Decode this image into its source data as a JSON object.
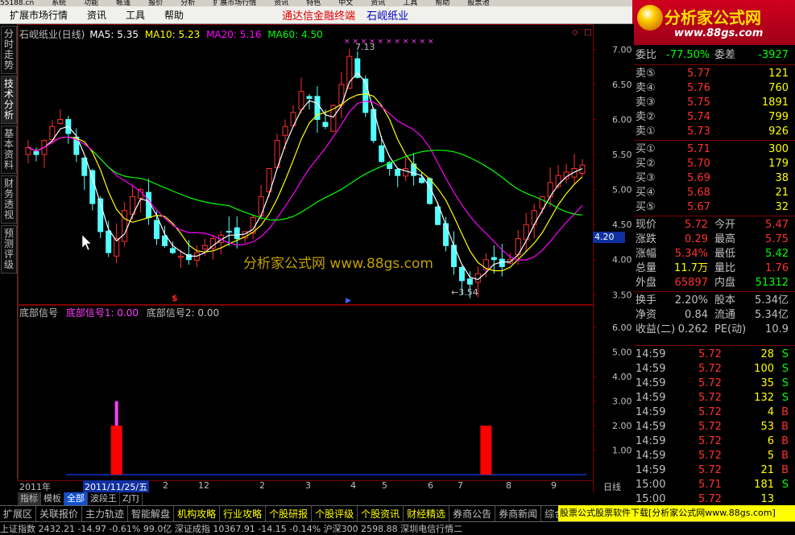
{
  "topstrip": [
    "55188.cn",
    "系统",
    "功能",
    "帐篷",
    "报价",
    "分析",
    "扩展市场行情",
    "资讯",
    "特色",
    "中文",
    "资讯",
    "工具",
    "帮助",
    "股票池"
  ],
  "menubar": {
    "items": [
      "扩展市场行情",
      "资讯",
      "工具",
      "帮助"
    ],
    "title": "通达信金融终端",
    "stock": "石岘纸业"
  },
  "logo": {
    "name": "分析家公式网",
    "url": "www.88gs.com"
  },
  "left_tabs": [
    "分时走势",
    "技术分析",
    "基本资料",
    "财务透视",
    "预测评级"
  ],
  "ma_header": {
    "stock": "石岘纸业(日线)",
    "ma5": "MA5: 5.35",
    "ma10": "MA10: 5.23",
    "ma20": "MA20: 5.16",
    "ma60": "MA60: 4.50"
  },
  "price_axis": [
    "7.00",
    "6.50",
    "6.00",
    "5.50",
    "5.00",
    "4.50",
    "4.00",
    "3.50"
  ],
  "current_price_tag": "4.20",
  "annotations": {
    "high": "7.13",
    "low": "3.54",
    "watermark": "分析家公式网 www.88gs.com"
  },
  "indicator_header": {
    "name": "底部信号",
    "s1": "底部信号1: 0.00",
    "s2": "底部信号2: 0.00"
  },
  "indicator_axis": [
    "6.00",
    "5.00",
    "4.00",
    "3.00",
    "2.00",
    "1.00"
  ],
  "time_axis": {
    "year": "2011年",
    "cursor": "2011/11/25/五",
    "ticks": [
      "2",
      "12",
      "2",
      "3",
      "4",
      "5",
      "6",
      "7",
      "8",
      "9"
    ],
    "period": "日线"
  },
  "chart_data": {
    "type": "candlestick",
    "title": "石岘纸业(日线)",
    "ylim": [
      3.4,
      7.2
    ],
    "highest": 7.13,
    "lowest": 3.54,
    "moving_averages": [
      {
        "name": "MA5",
        "value": 5.35,
        "color": "#ffffff"
      },
      {
        "name": "MA10",
        "value": 5.23,
        "color": "#ffff00"
      },
      {
        "name": "MA20",
        "value": 5.16,
        "color": "#ff00ff"
      },
      {
        "name": "MA60",
        "value": 4.5,
        "color": "#00ff00"
      }
    ],
    "closes": [
      5.6,
      5.5,
      5.7,
      5.9,
      6.0,
      5.8,
      5.5,
      5.2,
      4.8,
      4.4,
      4.1,
      4.3,
      4.7,
      4.9,
      5.0,
      4.6,
      4.3,
      4.2,
      4.1,
      4.05,
      4.0,
      4.1,
      4.2,
      4.3,
      4.35,
      4.4,
      4.3,
      4.4,
      4.6,
      4.9,
      5.3,
      5.7,
      5.9,
      6.1,
      6.4,
      6.3,
      6.0,
      5.9,
      6.2,
      6.5,
      6.9,
      6.6,
      6.1,
      5.7,
      5.4,
      5.3,
      5.2,
      5.3,
      5.2,
      5.1,
      4.8,
      4.5,
      4.2,
      3.9,
      3.7,
      3.65,
      3.8,
      4.0,
      4.0,
      3.9,
      4.0,
      4.3,
      4.5,
      4.7,
      4.9,
      5.1,
      5.2,
      5.25,
      5.3,
      5.35
    ],
    "indicator": {
      "name": "底部信号",
      "ylim": [
        0,
        6.5
      ],
      "signals": [
        {
          "at_index": 11,
          "series": "底部信号1",
          "value": 3.0
        },
        {
          "at_index": 11,
          "series": "底部信号2",
          "value": 2.0
        },
        {
          "at_index": 57,
          "series": "底部信号2",
          "value": 2.0
        }
      ]
    }
  },
  "orderbook": {
    "weibi": {
      "label": "委比",
      "value": "-77.50%",
      "label2": "委差",
      "value2": "-3927"
    },
    "sells": [
      {
        "label": "卖⑤",
        "price": "5.77",
        "vol": "121"
      },
      {
        "label": "卖④",
        "price": "5.76",
        "vol": "760"
      },
      {
        "label": "卖③",
        "price": "5.75",
        "vol": "1891"
      },
      {
        "label": "卖②",
        "price": "5.74",
        "vol": "799"
      },
      {
        "label": "卖①",
        "price": "5.73",
        "vol": "926"
      }
    ],
    "buys": [
      {
        "label": "买①",
        "price": "5.71",
        "vol": "300"
      },
      {
        "label": "买②",
        "price": "5.70",
        "vol": "179"
      },
      {
        "label": "买③",
        "price": "5.69",
        "vol": "38"
      },
      {
        "label": "买④",
        "price": "5.68",
        "vol": "21"
      },
      {
        "label": "买⑤",
        "price": "5.67",
        "vol": "32"
      }
    ]
  },
  "quote": [
    {
      "l1": "现价",
      "v1": "5.72",
      "c1": "#ff3030",
      "l2": "今开",
      "v2": "5.47",
      "c2": "#ff3030"
    },
    {
      "l1": "涨跌",
      "v1": "0.29",
      "c1": "#ff3030",
      "l2": "最高",
      "v2": "5.75",
      "c2": "#ff3030"
    },
    {
      "l1": "涨幅",
      "v1": "5.34%",
      "c1": "#ff3030",
      "l2": "最低",
      "v2": "5.42",
      "c2": "#00ff00"
    },
    {
      "l1": "总量",
      "v1": "11.7万",
      "c1": "#ffff00",
      "l2": "量比",
      "v2": "1.76",
      "c2": "#ff3030"
    },
    {
      "l1": "外盘",
      "v1": "65897",
      "c1": "#ff3030",
      "l2": "内盘",
      "v2": "51312",
      "c2": "#00ff00"
    }
  ],
  "fund": [
    {
      "l1": "换手",
      "v1": "2.20%",
      "l2": "股本",
      "v2": "5.34亿"
    },
    {
      "l1": "净资",
      "v1": "0.84",
      "l2": "流通",
      "v2": "5.34亿"
    },
    {
      "l1": "收益(二)",
      "v1": "0.262",
      "l2": "PE(动)",
      "v2": "10.9"
    }
  ],
  "ticks": [
    {
      "time": "14:59",
      "price": "5.72",
      "vol": "28",
      "side": "S"
    },
    {
      "time": "14:59",
      "price": "5.72",
      "vol": "100",
      "side": "S"
    },
    {
      "time": "14:59",
      "price": "5.72",
      "vol": "35",
      "side": "S"
    },
    {
      "time": "14:59",
      "price": "5.72",
      "vol": "132",
      "side": "S"
    },
    {
      "time": "14:59",
      "price": "5.72",
      "vol": "4",
      "side": "B"
    },
    {
      "time": "14:59",
      "price": "5.72",
      "vol": "53",
      "side": "B"
    },
    {
      "time": "14:59",
      "price": "5.72",
      "vol": "6",
      "side": "B"
    },
    {
      "time": "14:59",
      "price": "5.72",
      "vol": "5",
      "side": "B"
    },
    {
      "time": "14:59",
      "price": "5.72",
      "vol": "21",
      "side": "B"
    },
    {
      "time": "15:00",
      "price": "5.71",
      "vol": "181",
      "side": "S"
    },
    {
      "time": "15:00",
      "price": "5.72",
      "vol": "13",
      "side": ""
    }
  ],
  "bottom_tabs": [
    "指标",
    "模板",
    "全部",
    "波段王",
    "ZJTJ"
  ],
  "bottom_nav": [
    "扩展区",
    "关联报价",
    "主力轨迹",
    "智能解盘",
    "机构攻略",
    "行业攻略",
    "个股研报",
    "个股评级",
    "个股资讯",
    "财经精选",
    "券商公告",
    "券商新闻",
    "综合"
  ],
  "footer_banner": "股票公式股票软件下载[分析家公式网www.88gs.com]",
  "ticker": "上证指数 2432.21  -14.97  -0.61%   99.0亿   深证成指 10367.91  -14.15  -0.14%   沪深300 2598.88   深圳电信行情二"
}
